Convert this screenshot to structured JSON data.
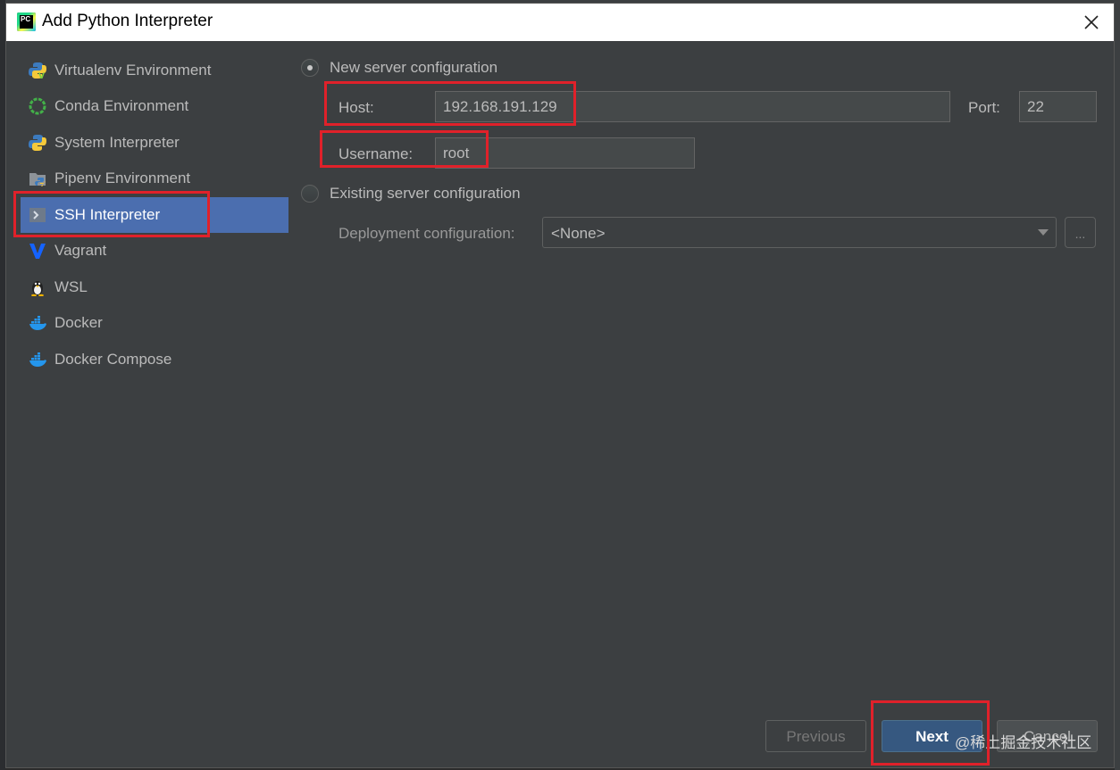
{
  "dialog": {
    "title": "Add Python Interpreter",
    "app_icon_text": "PC"
  },
  "sidebar": {
    "items": [
      {
        "label": "Virtualenv Environment",
        "icon": "python-virtualenv-icon"
      },
      {
        "label": "Conda Environment",
        "icon": "conda-icon"
      },
      {
        "label": "System Interpreter",
        "icon": "python-icon"
      },
      {
        "label": "Pipenv Environment",
        "icon": "pipenv-folder-icon"
      },
      {
        "label": "SSH Interpreter",
        "icon": "ssh-terminal-icon",
        "selected": true
      },
      {
        "label": "Vagrant",
        "icon": "vagrant-icon"
      },
      {
        "label": "WSL",
        "icon": "linux-penguin-icon"
      },
      {
        "label": "Docker",
        "icon": "docker-icon"
      },
      {
        "label": "Docker Compose",
        "icon": "docker-compose-icon"
      }
    ]
  },
  "ssh": {
    "new_server_label": "New server configuration",
    "new_server_selected": true,
    "host_label": "Host:",
    "host_value": "192.168.191.129",
    "port_label": "Port:",
    "port_value": "22",
    "username_label": "Username:",
    "username_value": "root",
    "existing_server_label": "Existing server configuration",
    "deployment_label": "Deployment configuration:",
    "deployment_value": "<None>",
    "browse_label": "..."
  },
  "buttons": {
    "previous": "Previous",
    "next": "Next",
    "cancel": "Cancel"
  },
  "watermark": "@稀土掘金技术社区",
  "colors": {
    "selection": "#4b6eaf",
    "dialog_bg": "#3c3f41",
    "highlight_box": "#e0212a",
    "next_button": "#365880"
  }
}
